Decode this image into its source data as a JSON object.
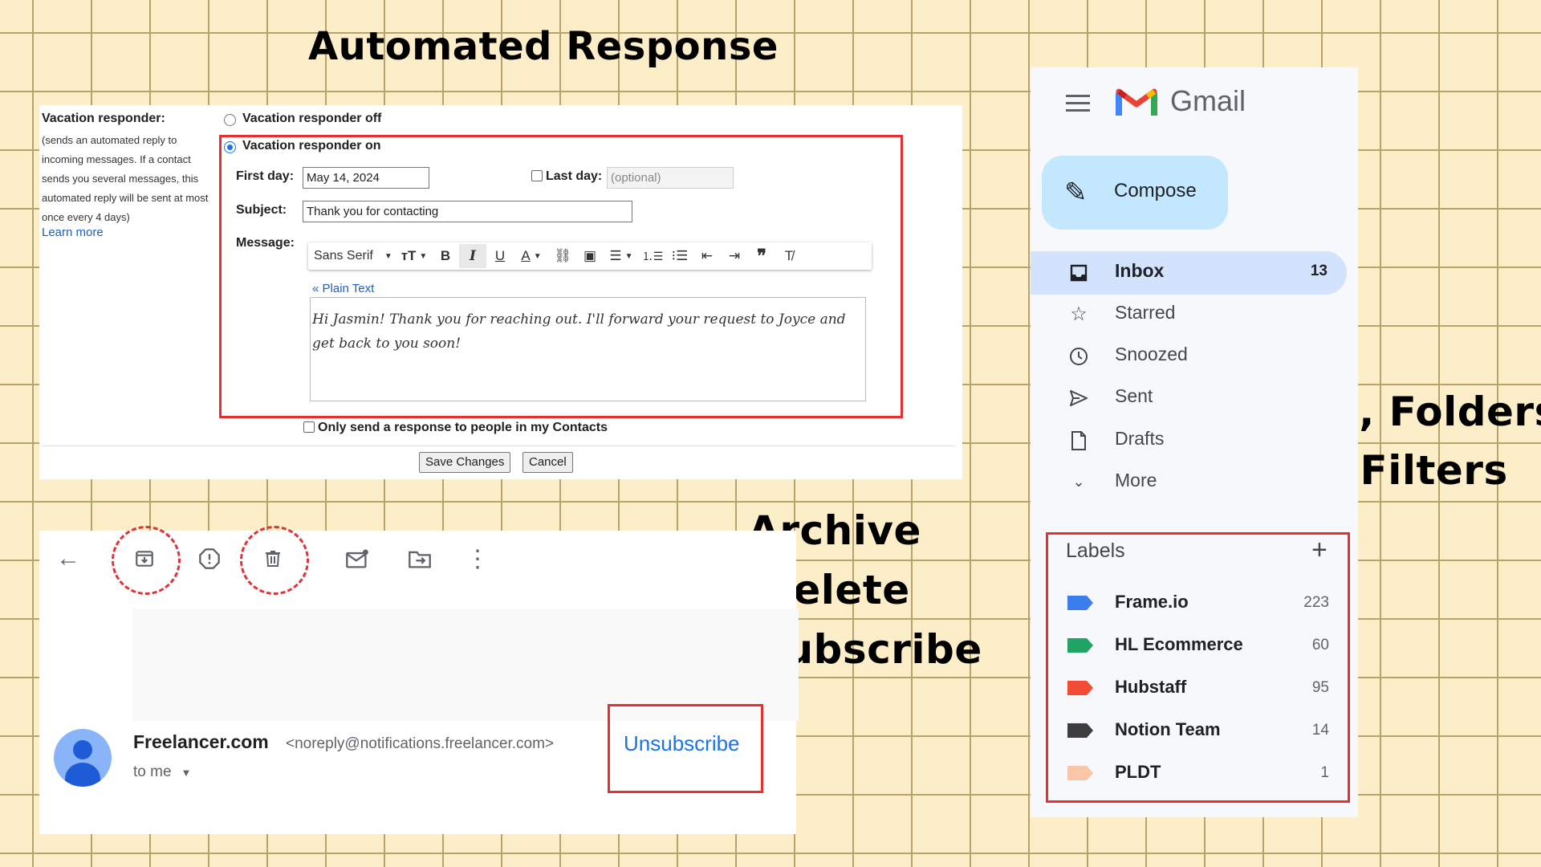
{
  "headings": {
    "automated": "Automated Response",
    "archive_lines": [
      "Archive",
      "Delete",
      "Unsubscribe"
    ],
    "labels_lines": [
      "Labels, Folders,",
      "and Filters"
    ]
  },
  "vacation": {
    "title": "Vacation responder:",
    "description": [
      "(sends an automated reply to",
      "incoming messages. If a contact",
      "sends you several messages, this",
      "automated reply will be sent at most",
      "once every 4 days)"
    ],
    "learn_more": "Learn more",
    "off_label": "Vacation responder off",
    "on_label": "Vacation responder on",
    "first_day_label": "First day:",
    "first_day_value": "May 14, 2024",
    "last_day_label": "Last day:",
    "last_day_placeholder": "(optional)",
    "subject_label": "Subject:",
    "subject_value": "Thank you for contacting",
    "message_label": "Message:",
    "font_name": "Sans Serif",
    "plain_text_link": "« Plain Text",
    "message_body": "Hi Jasmin! Thank you for reaching out. I'll forward your request to Joyce and get back to you soon!",
    "contacts_only_label": "Only send a response to people in my Contacts",
    "save_label": "Save Changes",
    "cancel_label": "Cancel"
  },
  "email": {
    "sender_name": "Freelancer.com",
    "sender_email": "<noreply@notifications.freelancer.com>",
    "recipient": "to me",
    "unsubscribe": "Unsubscribe"
  },
  "gmail": {
    "brand": "Gmail",
    "compose": "Compose",
    "nav": [
      {
        "label": "Inbox",
        "count": "13"
      },
      {
        "label": "Starred"
      },
      {
        "label": "Snoozed"
      },
      {
        "label": "Sent"
      },
      {
        "label": "Drafts"
      },
      {
        "label": "More"
      }
    ],
    "labels_title": "Labels",
    "labels": [
      {
        "name": "Frame.io",
        "count": "223",
        "color": "#3b7ded"
      },
      {
        "name": "HL Ecommerce",
        "count": "60",
        "color": "#1fa463"
      },
      {
        "name": "Hubstaff",
        "count": "95",
        "color": "#f24d34"
      },
      {
        "name": "Notion Team",
        "count": "14",
        "color": "#3d3d3d"
      },
      {
        "name": "PLDT",
        "count": "1",
        "color": "#fbc5a7"
      }
    ]
  }
}
